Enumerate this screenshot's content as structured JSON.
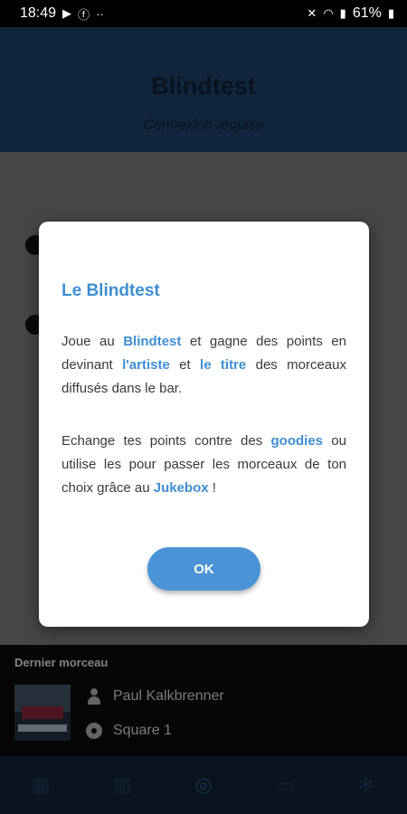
{
  "status_bar": {
    "time": "18:49",
    "battery": "61%"
  },
  "header": {
    "title": "Blindtest",
    "subtitle": "Connexion requise"
  },
  "dialog": {
    "title": "Le Blindtest",
    "p1": [
      {
        "t": "Joue au ",
        "h": false
      },
      {
        "t": "Blindtest",
        "h": true
      },
      {
        "t": " et gagne des points en devinant ",
        "h": false
      },
      {
        "t": "l'artiste",
        "h": true
      },
      {
        "t": " et ",
        "h": false
      },
      {
        "t": "le titre",
        "h": true
      },
      {
        "t": " des morceaux diffusés dans le bar.",
        "h": false
      }
    ],
    "p2": [
      {
        "t": "Echange tes points contre des ",
        "h": false
      },
      {
        "t": "goodies",
        "h": true
      },
      {
        "t": " ou utilise les pour passer les morceaux de ton choix grâce au ",
        "h": false
      },
      {
        "t": "Jukebox",
        "h": true
      },
      {
        "t": " !",
        "h": false
      }
    ],
    "ok_label": "OK"
  },
  "player": {
    "label": "Dernier morceau",
    "artist": "Paul Kalkbrenner",
    "track": "Square 1"
  },
  "tabs": [
    {
      "icon": "grid-icon"
    },
    {
      "icon": "bottle-icon"
    },
    {
      "icon": "gamepad-icon"
    },
    {
      "icon": "keyboard-icon"
    },
    {
      "icon": "snowflake-icon"
    }
  ]
}
